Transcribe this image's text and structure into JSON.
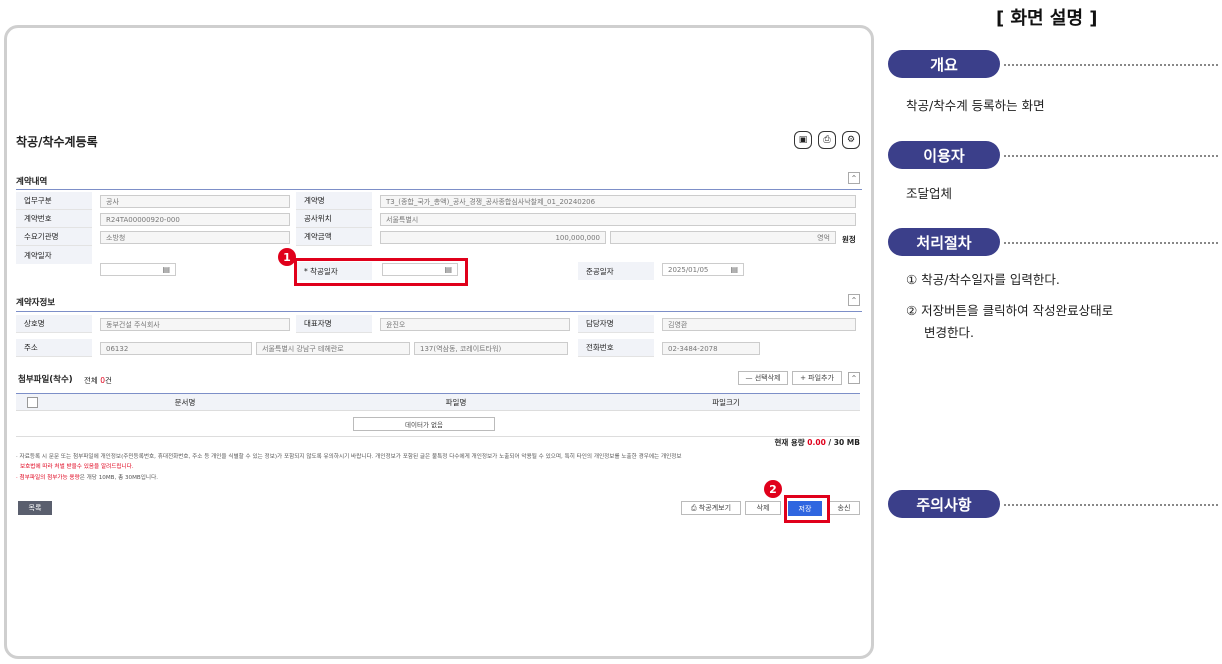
{
  "page": {
    "title": "착공/착수계등록"
  },
  "contract": {
    "section": "계약내역",
    "work_type_label": "업무구분",
    "work_type": "공사",
    "contract_name_label": "계약명",
    "contract_name": "T3_(종합_국가_총액)_공사_경쟁_공사종합심사낙찰제_01_20240206",
    "contract_no_label": "계약번호",
    "contract_no": "R24TA00000920-000",
    "site_label": "공사위치",
    "site": "서울특별시",
    "org_label": "수요기관명",
    "org": "소방청",
    "amount_label": "계약금액",
    "amount": "100,000,000",
    "amount_hangul": "영억",
    "amount_unit": "원정",
    "contract_date_label": "계약일자",
    "start_date_label": "* 착공일자",
    "completion_label": "준공일자",
    "completion": "2025/01/05"
  },
  "contractor": {
    "section": "계약자정보",
    "company_label": "상호명",
    "company": "동부건설 주식회사",
    "ceo_label": "대표자명",
    "ceo": "윤진오",
    "manager_label": "담당자명",
    "manager": "김영환",
    "address_label": "주소",
    "zip": "06132",
    "addr1": "서울특별시 강남구 테헤란로",
    "addr2": "137(역삼동, 코레이트타워)",
    "phone_label": "전화번호",
    "phone": "02-3484-2078"
  },
  "attach": {
    "title": "첨부파일(착수)",
    "total_prefix": "전체 ",
    "total_count": "0",
    "total_suffix": "건",
    "delete_btn": "— 선택삭제",
    "add_btn": "+ 파일추가",
    "col_doc": "문서명",
    "col_file": "파일명",
    "col_size": "파일크기",
    "empty": "데이터가 없음",
    "capacity_prefix": "현재 용량 ",
    "capacity_value": "0.00",
    "capacity_suffix": " / 30 MB"
  },
  "notice": {
    "line1": "· 자료등록 시 문문 또는 첨부파일에 개인정보(주민등록번호, 휴대전화번호, 주소 등 개인을 식별할 수 있는 정보)가 포함되지 않도록 유의하시기 바랍니다. 개인정보가 포함된 글은 불특정 다수에게 개인정보가 노출되어 악용될 수 있으며, 특히 타인의 개인정보를 노출한 경우에는 개인정보",
    "line2": "보호법에 따라 처벌 받을수 있음을 알려드립니다.",
    "line3_red": "· 첨부파일의 첨부가능 용량",
    "line3_rest": "은 개당 10MB, 총 30MB입니다."
  },
  "buttons": {
    "list": "목록",
    "preview": "⎙ 착공계보기",
    "delete": "삭제",
    "save": "저장",
    "send": "송신"
  },
  "markers": {
    "m1": "1",
    "m2": "2"
  },
  "right_panel": {
    "heading": "[ 화면 설명 ]",
    "overview_label": "개요",
    "overview_text": "착공/착수계 등록하는 화면",
    "user_label": "이용자",
    "user_text": "조달업체",
    "process_label": "처리절차",
    "step1": "① 착공/착수일자를 입력한다.",
    "step2a": "② 저장버튼을 클릭하여 작성완료상태로",
    "step2b": "변경한다.",
    "caution_label": "주의사항"
  },
  "colors": {
    "accent": "#3b3f8a",
    "marker": "#e0001b",
    "save_btn": "#2f66e0"
  }
}
